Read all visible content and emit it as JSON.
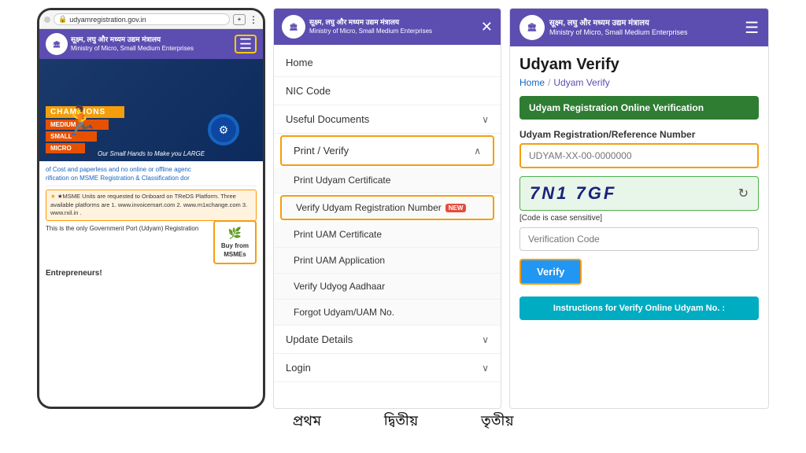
{
  "phone1": {
    "url": "udyamregistration.gov.in",
    "header": {
      "logo_text": "🏛",
      "title": "सूक्ष्म, लघु और मध्यम उद्यम मंत्रालय",
      "subtitle": "Ministry of Micro, Small Medium Enterprises"
    },
    "hero": {
      "stair1": "MICRO",
      "stair2": "SMALL",
      "stair3": "MEDIUM",
      "stair4": "CHAMPIONS",
      "tagline": "Our Small Hands to Make you LARGE"
    },
    "marquee_text": "of Cost and paperless and no online or offline agenc",
    "marquee_text2": "rification on MSME Registration & Classification dor",
    "notice": "★MSME Units are requested to Onboard on TReDS Platform. Three available platforms are 1. www.invoicemart.com 2. www.m1xchange.com 3. www.rxil.in .",
    "gov_text": "This is the only Government Port (Udyam) Registration",
    "buy_btn": "Buy from\nMSMEs",
    "entrepreneurs": "Entrepreneurs!"
  },
  "phone2": {
    "header": {
      "logo_text": "🏛",
      "title": "सूक्ष्म, लघु और मध्यम उद्यम मंत्रालय",
      "subtitle": "Ministry of Micro, Small Medium Enterprises"
    },
    "menu": {
      "items": [
        {
          "label": "Home",
          "has_arrow": false,
          "expanded": false
        },
        {
          "label": "NIC Code",
          "has_arrow": false,
          "expanded": false
        },
        {
          "label": "Useful Documents",
          "has_arrow": true,
          "expanded": false
        },
        {
          "label": "Print / Verify",
          "has_arrow": true,
          "expanded": true,
          "highlighted": true
        },
        {
          "label": "Update Details",
          "has_arrow": true,
          "expanded": false
        },
        {
          "label": "Login",
          "has_arrow": true,
          "expanded": false
        }
      ],
      "sub_items": [
        {
          "label": "Print Udyam Certificate",
          "highlighted": false
        },
        {
          "label": "Verify Udyam Registration Number",
          "highlighted": true,
          "badge": "NEW"
        },
        {
          "label": "Print UAM Certificate",
          "highlighted": false
        },
        {
          "label": "Print UAM Application",
          "highlighted": false
        },
        {
          "label": "Verify Udyog Aadhaar",
          "highlighted": false
        },
        {
          "label": "Forgot Udyam/UAM No.",
          "highlighted": false
        }
      ]
    }
  },
  "phone3": {
    "header": {
      "logo_text": "🏛",
      "title": "सूक्ष्म, लघु और मध्यम उद्यम मंत्रालय",
      "subtitle": "Ministry of Micro, Small Medium Enterprises"
    },
    "page_title": "Udyam Verify",
    "breadcrumb": {
      "home": "Home",
      "separator": "/",
      "current": "Udyam Verify"
    },
    "section_title": "Udyam Registration Online Verification",
    "form": {
      "ref_label": "Udyam Registration/Reference Number",
      "ref_placeholder": "UDYAM-XX-00-0000000",
      "captcha_value": "7N1 7GF",
      "captcha_hint": "[Code is case sensitive]",
      "verification_placeholder": "Verification Code",
      "verify_btn": "Verify",
      "instructions_btn": "Instructions for Verify Online Udyam No. :"
    }
  },
  "bottom_labels": {
    "label1": "প্রথম",
    "label2": "দ্বিতীয়",
    "label3": "তৃতীয়"
  }
}
